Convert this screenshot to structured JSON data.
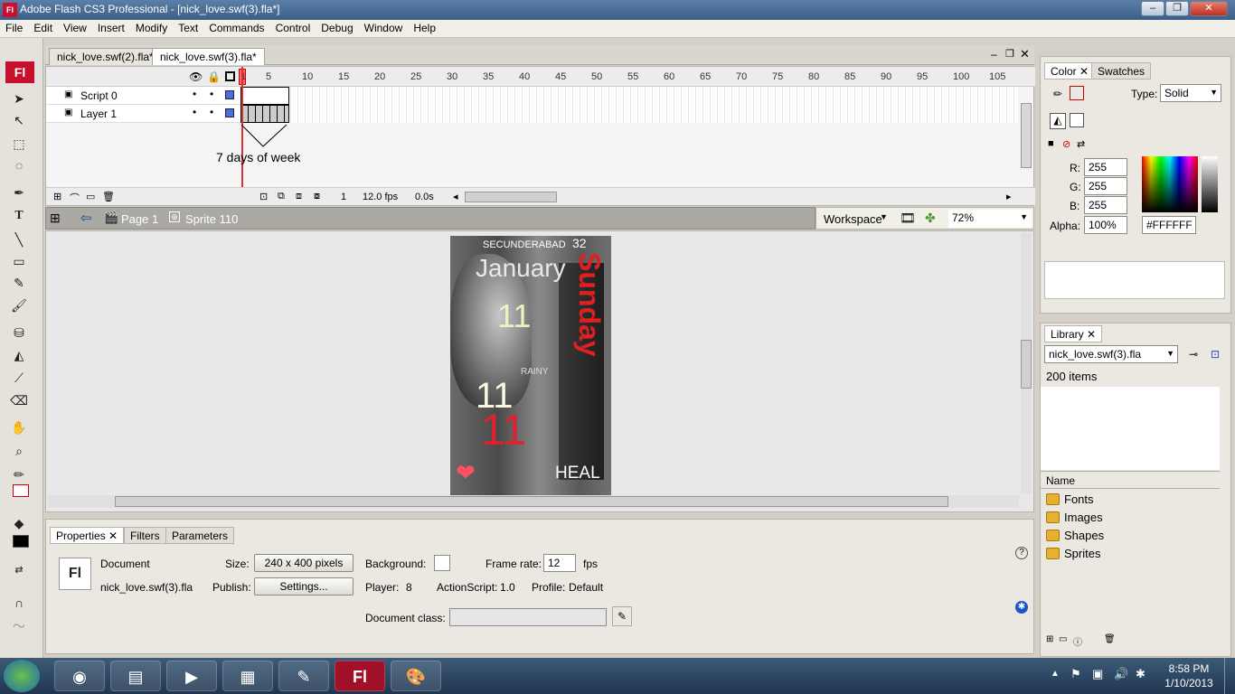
{
  "window": {
    "title": "Adobe Flash CS3 Professional - [nick_love.swf(3).fla*]",
    "app_icon": "Fl"
  },
  "menu": [
    "File",
    "Edit",
    "View",
    "Insert",
    "Modify",
    "Text",
    "Commands",
    "Control",
    "Debug",
    "Window",
    "Help"
  ],
  "doc_tabs": [
    {
      "label": "nick_love.swf(2).fla*"
    },
    {
      "label": "nick_love.swf(3).fla*"
    }
  ],
  "timeline": {
    "ruler": [
      "1",
      "5",
      "10",
      "15",
      "20",
      "25",
      "30",
      "35",
      "40",
      "45",
      "50",
      "55",
      "60",
      "65",
      "70",
      "75",
      "80",
      "85",
      "90",
      "95",
      "100",
      "105"
    ],
    "layers": [
      {
        "name": "Script 0"
      },
      {
        "name": "Layer 1"
      }
    ],
    "annotation": "7 days of week",
    "current_frame": "1",
    "fps": "12.0 fps",
    "time": "0.0s"
  },
  "editbar": {
    "scene": "Page 1",
    "symbol": "Sprite 110",
    "workspace": "Workspace",
    "zoom": "72%"
  },
  "artwork": {
    "city": "SECUNDERABAD",
    "temp": "32",
    "month": "January",
    "weekday": "Sunday",
    "weather": "RAINY",
    "day1": "11",
    "day2": "11",
    "day3": "11",
    "footer": "HEAL"
  },
  "properties": {
    "tabs": [
      "Properties",
      "Filters",
      "Parameters"
    ],
    "doc_label": "Document",
    "doc_name": "nick_love.swf(3).fla",
    "size_label": "Size:",
    "size_value": "240 x 400 pixels",
    "bg_label": "Background:",
    "fr_label": "Frame rate:",
    "fr_value": "12",
    "fps": "fps",
    "publish_label": "Publish:",
    "settings": "Settings...",
    "player_label": "Player:",
    "player_value": "8",
    "as_label": "ActionScript:",
    "as_value": "1.0",
    "profile_label": "Profile:",
    "profile_value": "Default",
    "docclass_label": "Document class:"
  },
  "color": {
    "tabs": [
      "Color",
      "Swatches"
    ],
    "type_label": "Type:",
    "type_value": "Solid",
    "r": "255",
    "g": "255",
    "b": "255",
    "alpha": "100%",
    "hex": "#FFFFFF",
    "r_label": "R:",
    "g_label": "G:",
    "b_label": "B:",
    "alpha_label": "Alpha:"
  },
  "library": {
    "tab": "Library",
    "doc": "nick_love.swf(3).fla",
    "count": "200 items",
    "col_name": "Name",
    "items": [
      "Fonts",
      "Images",
      "Shapes",
      "Sprites"
    ]
  },
  "clock": {
    "time": "8:58 PM",
    "date": "1/10/2013"
  }
}
